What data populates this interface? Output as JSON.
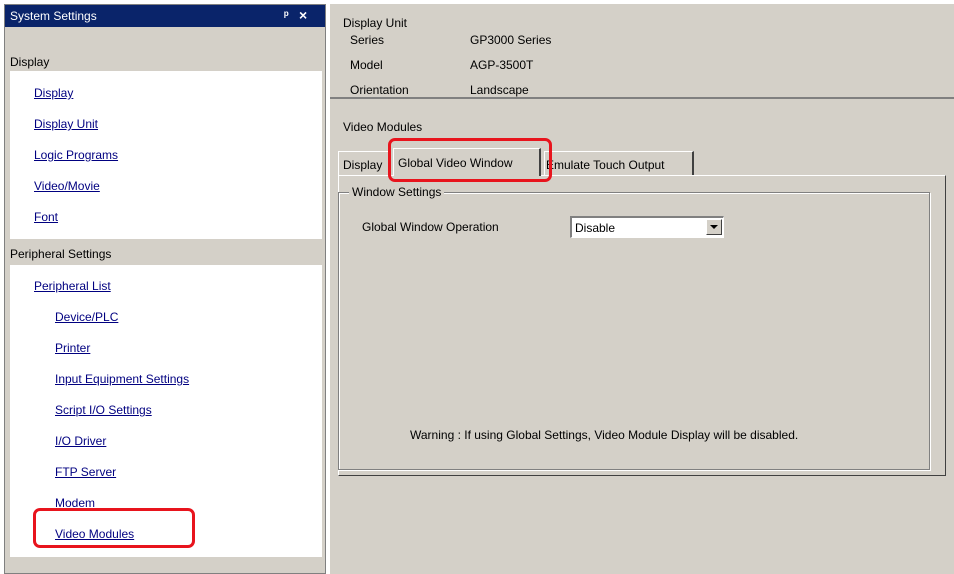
{
  "panel": {
    "title": "System Settings",
    "pin_icon": "pin-icon",
    "close_icon": "close-icon"
  },
  "display_group": {
    "header": "Display",
    "items": [
      "Display",
      "Display Unit",
      "Logic Programs",
      "Video/Movie",
      "Font"
    ]
  },
  "peripheral_group": {
    "header": "Peripheral Settings",
    "items": [
      "Peripheral List",
      "Device/PLC",
      "Printer",
      "Input Equipment Settings",
      "Script I/O Settings",
      "I/O Driver",
      "FTP Server",
      "Modem",
      "Video Modules"
    ]
  },
  "display_unit": {
    "title": "Display Unit",
    "series_label": "Series",
    "series_value": "GP3000 Series",
    "model_label": "Model",
    "model_value": "AGP-3500T",
    "orientation_label": "Orientation",
    "orientation_value": "Landscape"
  },
  "video_modules": {
    "title": "Video Modules",
    "tabs": [
      "Display",
      "Global Video Window",
      "Emulate Touch Output"
    ],
    "active_tab": "Global Video Window",
    "group_title": "Window Settings",
    "operation_label": "Global Window Operation",
    "operation_value": "Disable",
    "warning": "Warning : If using Global Settings, Video Module Display will be disabled."
  },
  "colors": {
    "title_bar": "#0a246a",
    "window_bg": "#d4d0c8",
    "link": "#000080",
    "highlight": "#e8141d"
  }
}
